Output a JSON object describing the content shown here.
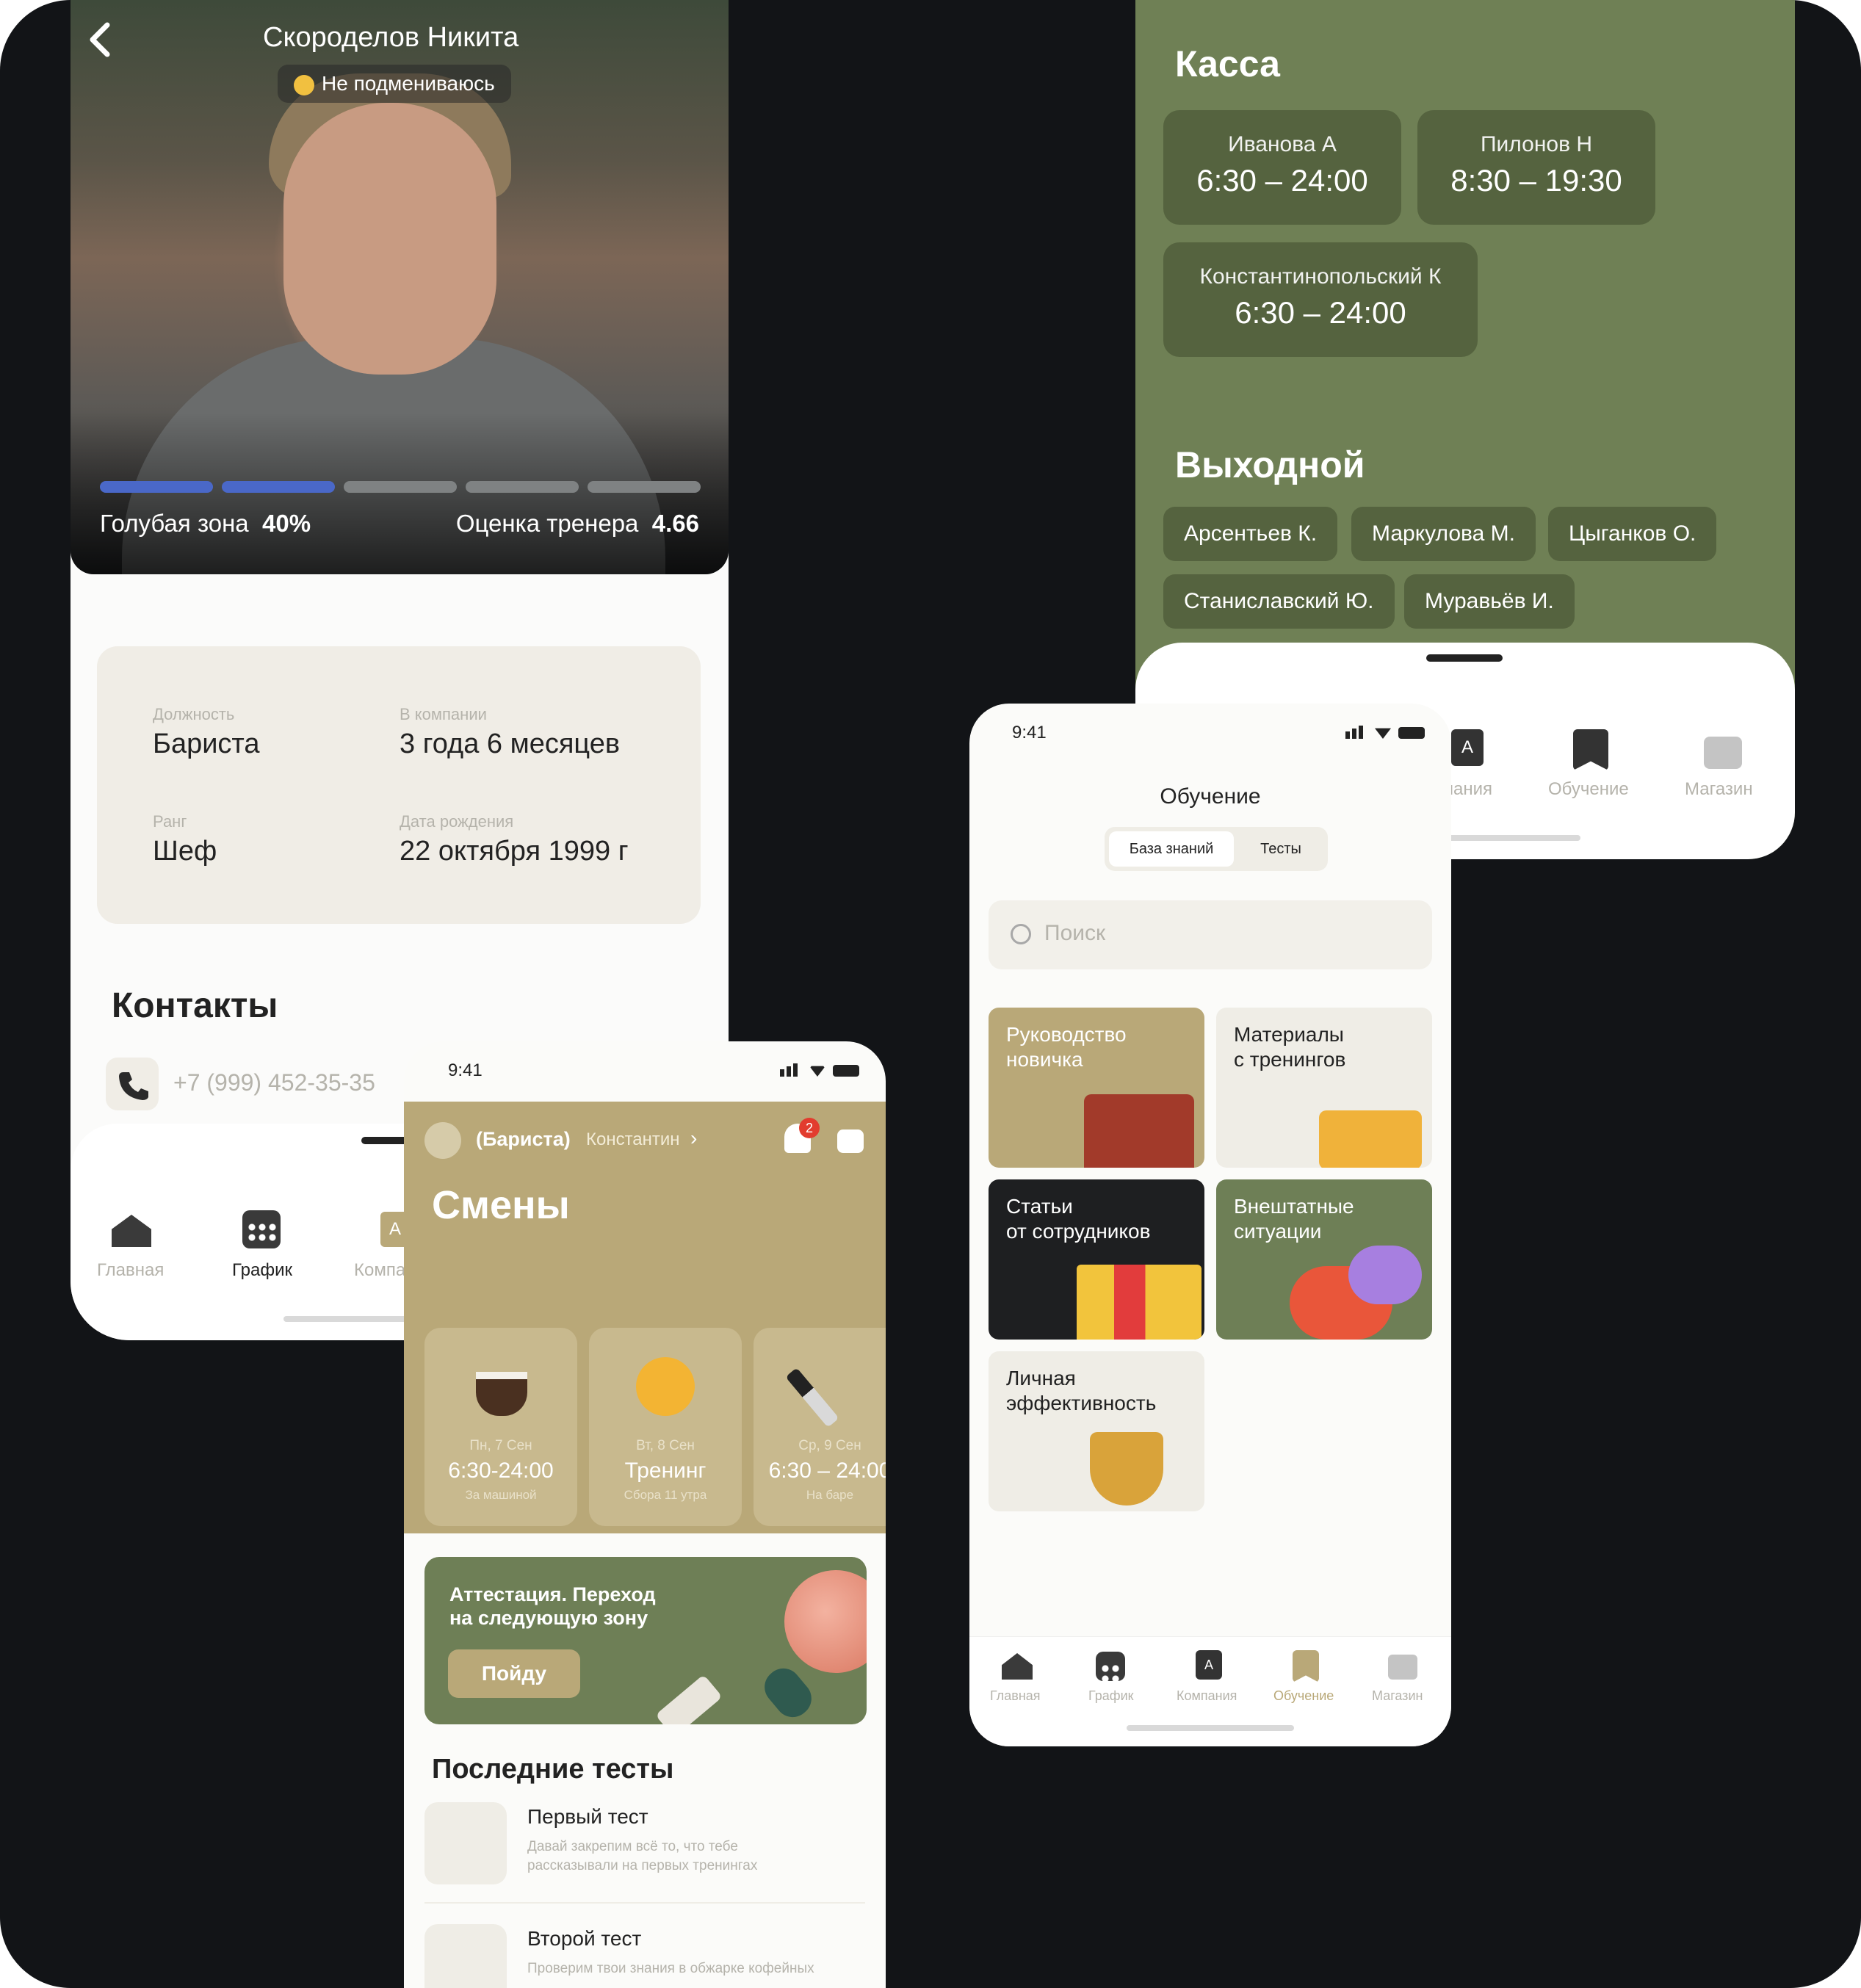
{
  "profile": {
    "name": "Скороделов Никита",
    "status_badge": "Не подмениваюсь",
    "zone_label": "Голубая зона",
    "zone_value": "40%",
    "zone_progress": 0.4,
    "coach_label": "Оценка тренера",
    "coach_value": "4.66",
    "info": {
      "position_label": "Должность",
      "position_value": "Бариста",
      "company_label": "В компании",
      "company_value": "3 года 6 месяцев",
      "rank_label": "Ранг",
      "rank_value": "Шеф",
      "birth_label": "Дата рождения",
      "birth_value": "22 октября 1999 г"
    },
    "contacts_title": "Контакты",
    "phone": "+7 (999) 452-35-35",
    "nav": {
      "home": "Главная",
      "schedule": "График",
      "company": "Компа"
    }
  },
  "schedule": {
    "kassa_title": "Касса",
    "tiles": [
      {
        "name": "Иванова А",
        "time": "6:30 – 24:00"
      },
      {
        "name": "Пилонов Н",
        "time": "8:30 – 19:30"
      },
      {
        "name": "Константинопольский К",
        "time": "6:30 – 24:00"
      }
    ],
    "dayoff_title": "Выходной",
    "dayoff": [
      "Арсентьев К.",
      "Маркулова М.",
      "Цыганков О.",
      "Станиславский Ю.",
      "Муравьёв И."
    ],
    "nav": {
      "company": "пания",
      "learning": "Обучение",
      "shop": "Магазин"
    }
  },
  "shifts": {
    "time": "9:41",
    "role": "(Бариста)",
    "user": "Константин",
    "notif_count": "2",
    "title": "Смены",
    "cards": [
      {
        "day": "Пн, 7 Сен",
        "time": "6:30-24:00",
        "sub": "За машиной"
      },
      {
        "day": "Вт, 8 Сен",
        "time": "Тренинг",
        "sub": "Сбора 11 утра"
      },
      {
        "day": "Ср, 9 Сен",
        "time": "6:30 – 24:00",
        "sub": "На баре"
      }
    ],
    "promo_text_1": "Аттестация. Переход",
    "promo_text_2": "на следующую зону",
    "promo_button": "Пойду",
    "tests_title": "Последние тесты",
    "tests": [
      {
        "title": "Первый тест",
        "desc1": "Давай закрепим всё то, что тебе",
        "desc2": "рассказывали на первых тренингах"
      },
      {
        "title": "Второй тест",
        "desc1": "Проверим твои знания в обжарке кофейных",
        "desc2": ""
      }
    ]
  },
  "learning": {
    "time": "9:41",
    "title": "Обучение",
    "tab_active": "База знаний",
    "tab_other": "Тесты",
    "search_placeholder": "Поиск",
    "cards": [
      {
        "l1": "Руководство",
        "l2": "новичка"
      },
      {
        "l1": "Материалы",
        "l2": "с тренингов"
      },
      {
        "l1": "Статьи",
        "l2": "от сотрудников"
      },
      {
        "l1": "Внештатные",
        "l2": "ситуации"
      },
      {
        "l1": "Личная",
        "l2": "эффективность"
      }
    ],
    "nav": {
      "home": "Главная",
      "schedule": "График",
      "company": "Компания",
      "learning": "Обучение",
      "shop": "Магазин"
    }
  },
  "colors": {
    "olive": "#6f8055",
    "sand": "#b9a878",
    "blue": "#4a68c8",
    "dark_bg": "#121417"
  }
}
